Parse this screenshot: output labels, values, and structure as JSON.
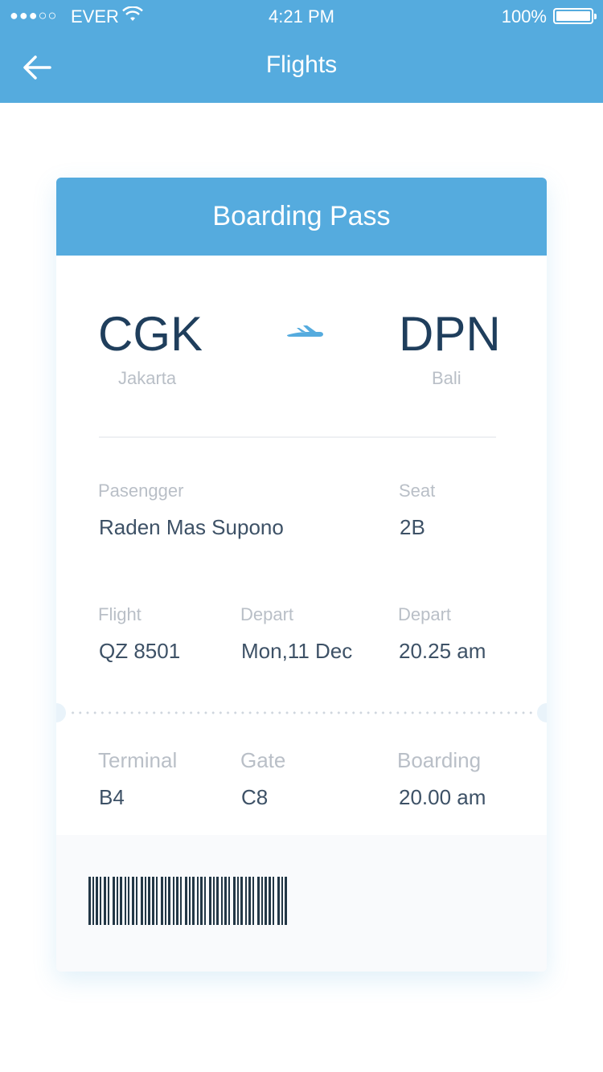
{
  "status_bar": {
    "signal": "●●●○○",
    "carrier": "EVER",
    "time": "4:21 PM",
    "battery": "100%"
  },
  "nav": {
    "title": "Flights",
    "back_icon": "arrow-left-icon"
  },
  "card": {
    "title": "Boarding Pass",
    "origin": {
      "code": "CGK",
      "city": "Jakarta"
    },
    "destination": {
      "code": "DPN",
      "city": "Bali"
    },
    "plane_icon": "plane-icon",
    "passenger": {
      "label": "Pasengger",
      "value": "Raden Mas Supono"
    },
    "seat": {
      "label": "Seat",
      "value": "2B"
    },
    "flight": {
      "label": "Flight",
      "value": "QZ 8501"
    },
    "depart_date": {
      "label": "Depart",
      "value": "Mon,11 Dec"
    },
    "depart_time": {
      "label": "Depart",
      "value": "20.25 am"
    },
    "terminal": {
      "label": "Terminal",
      "value": "B4"
    },
    "gate": {
      "label": "Gate",
      "value": "C8"
    },
    "boarding": {
      "label": "Boarding",
      "value": "20.00 am"
    }
  },
  "colors": {
    "accent": "#55abde",
    "code_text": "#1f3e5c",
    "value_text": "#3d5166",
    "label_text": "#b9bfc7",
    "barcode": "#233746"
  }
}
